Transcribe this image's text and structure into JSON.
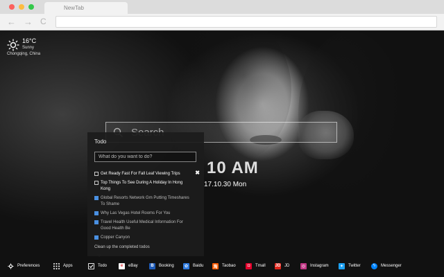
{
  "browser": {
    "tab_title": "NewTab",
    "nav": {
      "back": "←",
      "forward": "→",
      "reload": "C"
    }
  },
  "weather": {
    "temperature": "16°C",
    "condition": "Sunny",
    "location": "Chongqing, China",
    "icon": "sun-icon"
  },
  "search": {
    "placeholder": "Search"
  },
  "clock": {
    "time": "10 AM",
    "date": "17.10.30 Mon"
  },
  "todo": {
    "title": "Todo",
    "input_placeholder": "What do you want to do?",
    "items": [
      {
        "text": "Get Ready Fast For Fall Leaf Viewing Trips",
        "done": false
      },
      {
        "text": "Top Things To See During A Holiday In Hong Kong",
        "done": false
      },
      {
        "text": "Global Resorts Network Gm Putting Timeshares To Shame",
        "done": true
      },
      {
        "text": "Why Las Vegas Hotel Rooms For You",
        "done": true
      },
      {
        "text": "Travel Health Useful Medical Information For Good Health Be",
        "done": true
      },
      {
        "text": "Copper Canyon",
        "done": true
      }
    ],
    "close_label": "✖",
    "clear_label": "Clean up the completed todos"
  },
  "bottom_bar": {
    "preferences": "Preferences",
    "apps": "Apps",
    "todo": "Todo",
    "links": [
      {
        "label": "eBay",
        "icon": "ebay-icon",
        "color": "#ffffff"
      },
      {
        "label": "Booking",
        "icon": "booking-icon",
        "color": "#1e5bb8"
      },
      {
        "label": "Baidu",
        "icon": "baidu-icon",
        "color": "#2f7be0"
      },
      {
        "label": "Taobao",
        "icon": "taobao-icon",
        "color": "#ff5a00"
      },
      {
        "label": "Tmall",
        "icon": "tmall-icon",
        "color": "#e4002b"
      },
      {
        "label": "JD",
        "icon": "jd-icon",
        "color": "#e1251b"
      },
      {
        "label": "Instagram",
        "icon": "instagram-icon",
        "color": "#c13584"
      },
      {
        "label": "Twitter",
        "icon": "twitter-icon",
        "color": "#1da1f2"
      },
      {
        "label": "Messenger",
        "icon": "messenger-icon",
        "color": "#0084ff"
      }
    ]
  }
}
